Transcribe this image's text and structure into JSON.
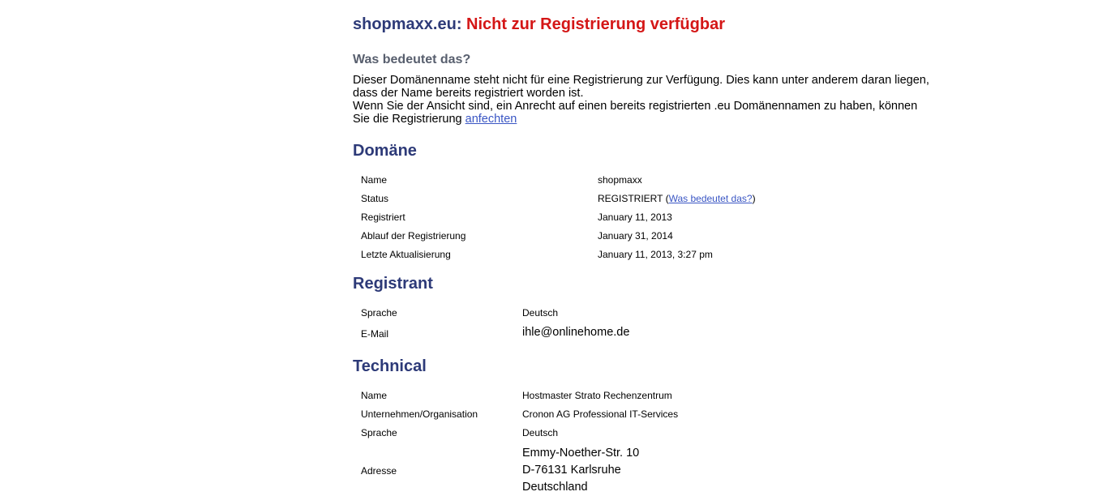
{
  "header": {
    "domain": "shopmaxx.eu:",
    "status": "Nicht zur Registrierung verfügbar"
  },
  "info": {
    "subheading": "Was bedeutet das?",
    "line1": "Dieser Domänenname steht nicht für eine Registrierung zur Verfügung. Dies kann unter anderem daran liegen, dass der Name bereits registriert worden ist.",
    "line2": "Wenn Sie der Ansicht sind, ein Anrecht auf einen bereits registrierten .eu Domänennamen zu haben, können Sie die Registrierung",
    "link": "anfechten"
  },
  "domain_section": {
    "heading": "Domäne",
    "name_label": "Name",
    "name_value": "shopmaxx",
    "status_label": "Status",
    "status_value": "REGISTRIERT",
    "status_open": "(",
    "status_link": "Was bedeutet das?",
    "status_close": ")",
    "registered_label": "Registriert",
    "registered_value": "January 11, 2013",
    "expiry_label": "Ablauf der Registrierung",
    "expiry_value": "January 31, 2014",
    "updated_label": "Letzte Aktualisierung",
    "updated_value": "January 11, 2013, 3:27 pm"
  },
  "registrant": {
    "heading": "Registrant",
    "language_label": "Sprache",
    "language_value": "Deutsch",
    "email_label": "E-Mail",
    "email_value": "ihle@onlinehome.de"
  },
  "technical": {
    "heading": "Technical",
    "name_label": "Name",
    "name_value": "Hostmaster Strato Rechenzentrum",
    "org_label": "Unternehmen/Organisation",
    "org_value": "Cronon AG Professional IT-Services",
    "language_label": "Sprache",
    "language_value": "Deutsch",
    "address_label": "Adresse",
    "address_lines": [
      "Emmy-Noether-Str. 10",
      "D-76131 Karlsruhe",
      "Deutschland"
    ]
  }
}
